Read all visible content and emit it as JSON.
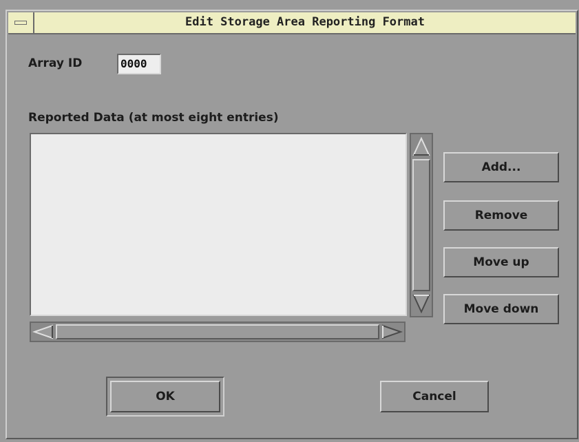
{
  "window": {
    "title": "Edit Storage Area Reporting Format"
  },
  "array_id": {
    "label": "Array ID",
    "value": "0000"
  },
  "reported_data": {
    "label": "Reported Data (at most eight entries)",
    "items": []
  },
  "side_buttons": {
    "add": "Add...",
    "remove": "Remove",
    "move_up": "Move up",
    "move_down": "Move down"
  },
  "footer_buttons": {
    "ok": "OK",
    "cancel": "Cancel"
  },
  "colors": {
    "title_bar": "#eeeec2",
    "panel": "#9b9b9b",
    "list_background": "#ececec"
  }
}
